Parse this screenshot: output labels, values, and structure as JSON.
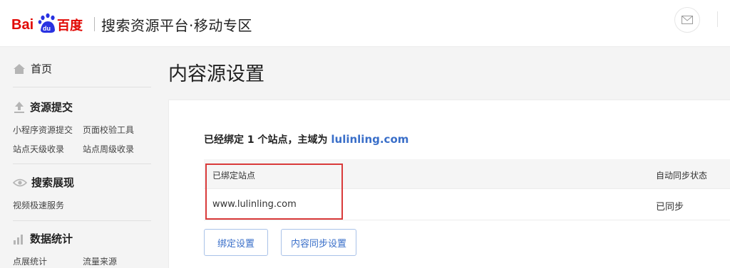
{
  "header": {
    "logo_text": "Bai百度",
    "platform_title": "搜索资源平台·移动专区",
    "mail_icon": "mail-icon"
  },
  "sidebar": {
    "home": {
      "label": "首页",
      "icon": "home-icon"
    },
    "sections": [
      {
        "title": "资源提交",
        "icon": "upload-icon",
        "links": [
          "小程序资源提交",
          "页面校验工具",
          "站点天级收录",
          "站点周级收录"
        ]
      },
      {
        "title": "搜索展现",
        "icon": "eye-icon",
        "links": [
          "视频极速服务"
        ]
      },
      {
        "title": "数据统计",
        "icon": "stats-icon",
        "links": [
          "点展统计",
          "流量来源"
        ]
      }
    ]
  },
  "main": {
    "page_title": "内容源设置",
    "bound_info": {
      "prefix": "已经绑定 1 个站点，主域为 ",
      "domain": "lulinling.com"
    },
    "table": {
      "headers": [
        "已绑定站点",
        "自动同步状态"
      ],
      "rows": [
        {
          "site": "www.lulinling.com",
          "status": "已同步"
        }
      ]
    },
    "buttons": {
      "bind_settings": "绑定设置",
      "sync_settings": "内容同步设置"
    }
  },
  "colors": {
    "accent": "#3a6fc9",
    "logo_red": "#e10602",
    "logo_blue": "#2932e1",
    "highlight": "#d93a3a"
  }
}
